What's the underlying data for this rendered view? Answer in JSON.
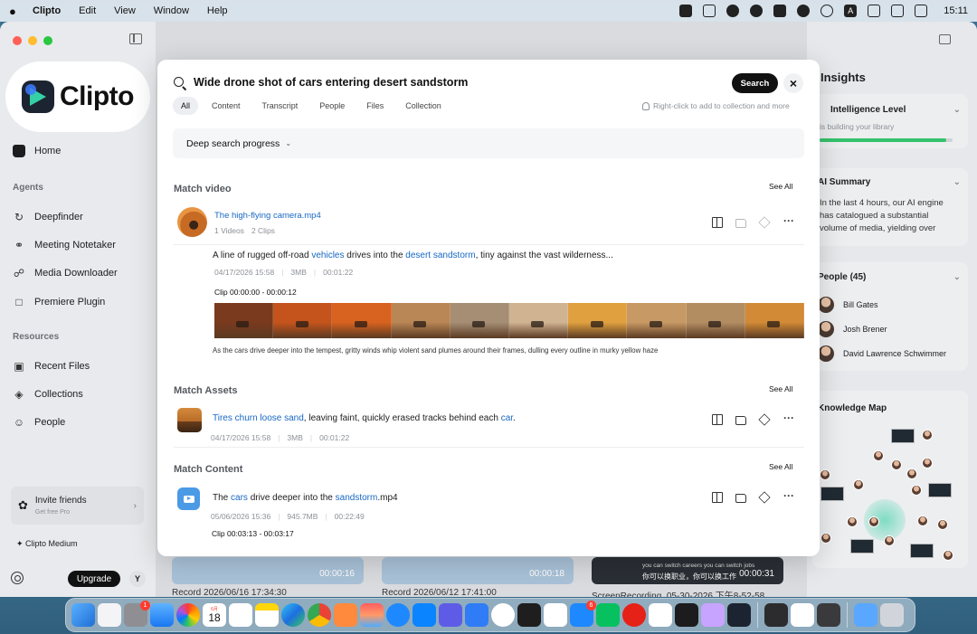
{
  "menubar": {
    "app_name": "Clipto",
    "menus": [
      "Edit",
      "View",
      "Window",
      "Help"
    ],
    "clock": "15:11",
    "input_indicator": "A"
  },
  "sidebar": {
    "logo_text": "Clipto",
    "home": "Home",
    "agents_label": "Agents",
    "agents": [
      "Deepfinder",
      "Meeting Notetaker",
      "Media Downloader",
      "Premiere Plugin"
    ],
    "resources_label": "Resources",
    "resources": [
      "Recent Files",
      "Collections",
      "People"
    ],
    "invite_title": "Invite friends",
    "invite_sub": "Get free Pro",
    "medium_label": "Clipto Medium",
    "upgrade_label": "Upgrade",
    "user_initial": "Y"
  },
  "insights": {
    "title": "Insights",
    "intelligence_title": "Intelligence Level",
    "intelligence_sub": "is building your library",
    "intelligence_progress": 0.95,
    "summary_title": "AI Summary",
    "summary_lines": [
      "In the last 4 hours, our AI engine",
      "has catalogued a substantial",
      "volume of media, yielding over"
    ],
    "people_title": "People (45)",
    "people": [
      "Bill Gates",
      "Josh Brener",
      "David Lawrence Schwimmer"
    ],
    "knowledge_title": "Knowledge Map"
  },
  "background": {
    "cards": [
      {
        "duration": "00:00:16",
        "label": "Record 2026/06/16 17:34:30"
      },
      {
        "duration": "00:00:18",
        "label": "Record 2026/06/12 17:41:00"
      },
      {
        "duration": "00:00:31",
        "label": "ScreenRecording_05-30-2026 下午8-52-58",
        "subtitle_en": "you can switch careers you can switch jobs",
        "subtitle_zh": "你可以换职业，你可以换工作"
      }
    ]
  },
  "search": {
    "query": "Wide drone shot of cars entering desert sandstorm",
    "button": "Search",
    "tabs": [
      "All",
      "Content",
      "Transcript",
      "People",
      "Files",
      "Collection"
    ],
    "active_tab": "All",
    "hint": "Right-click to add to collection and more",
    "deep_progress": "Deep search progress"
  },
  "results": {
    "see_all": "See All",
    "match_video": {
      "heading": "Match video",
      "title": "The high-flying camera.mp4",
      "videos": "1 Videos",
      "clips": "2 Clips",
      "desc_parts": [
        "A line of rugged off-road ",
        "vehicles",
        " drives into the ",
        "desert sandstorm",
        ", tiny against the vast wilderness..."
      ],
      "date": "04/17/2026 15:58",
      "size": "3MB",
      "duration": "00:01:22",
      "clip_label": "Clip 00:00:00 - 00:00:12",
      "frame_colors": [
        "#7a3a1e",
        "#c4541c",
        "#d8621f",
        "#b98655",
        "#a58e74",
        "#d0b391",
        "#e0a040",
        "#c79964",
        "#b38d62",
        "#d28a36"
      ],
      "caption": "As the cars drive deeper into the tempest, gritty winds whip violent sand plumes around their frames, dulling every outline in murky yellow haze"
    },
    "match_assets": {
      "heading": "Match Assets",
      "desc_parts": [
        "Tires churn loose sand",
        ", leaving faint, quickly erased tracks behind each ",
        "car",
        "."
      ],
      "date": "04/17/2026 15:58",
      "size": "3MB",
      "duration": "00:01:22"
    },
    "match_content": {
      "heading": "Match Content",
      "desc_parts": [
        "The ",
        "cars",
        " drive deeper into the ",
        "sandstorm",
        ".mp4"
      ],
      "date": "05/06/2026 15:36",
      "size": "945.7MB",
      "duration": "00:22:49",
      "clip_label": "Clip 00:03:13 - 00:03:17"
    }
  },
  "dock": {
    "calendar_month": "6月",
    "calendar_day": "18",
    "settings_badge": "1",
    "messages_badge": "6"
  },
  "colors": {
    "accent_link": "#1768c4",
    "progress_green": "#34c36b",
    "dark_button": "#111111"
  }
}
